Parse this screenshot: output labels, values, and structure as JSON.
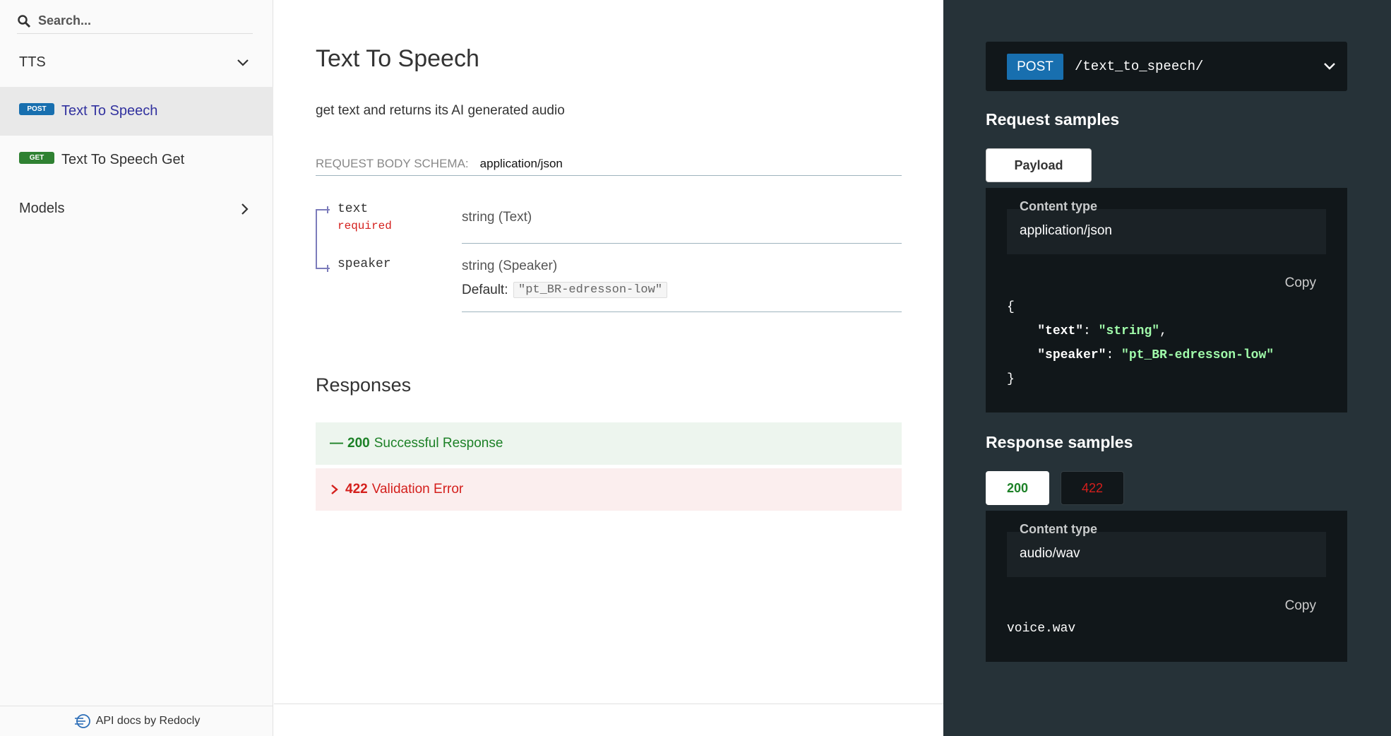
{
  "sidebar": {
    "search_placeholder": "Search...",
    "groups": [
      {
        "label": "TTS",
        "icon": "chevron-down-icon"
      },
      {
        "label": "Models",
        "icon": "chevron-right-icon"
      }
    ],
    "items": [
      {
        "method": "POST",
        "label": "Text To Speech",
        "active": true
      },
      {
        "method": "GET",
        "label": "Text To Speech Get",
        "active": false
      }
    ],
    "footer": "API docs by Redocly"
  },
  "main": {
    "title": "Text To Speech",
    "description": "get text and returns its AI generated audio",
    "schema_label": "REQUEST BODY SCHEMA:",
    "schema_type": "application/json",
    "fields": [
      {
        "name": "text",
        "required": "required",
        "type": "string (Text)"
      },
      {
        "name": "speaker",
        "type": "string (Speaker)",
        "default_label": "Default:",
        "default_value": "\"pt_BR-edresson-low\""
      }
    ],
    "responses_title": "Responses",
    "responses": [
      {
        "prefix": "—",
        "code": "200",
        "label": "Successful Response",
        "color": "#1d8127"
      },
      {
        "prefix": ">",
        "code": "422",
        "label": "Validation Error",
        "color": "#d41f1c"
      }
    ]
  },
  "panel": {
    "method": "POST",
    "path": "/text_to_speech/",
    "request_title": "Request samples",
    "request_tab": "Payload",
    "request_content_type_label": "Content type",
    "request_content_type": "application/json",
    "copy_label": "Copy",
    "payload": {
      "open": "{",
      "key1": "\"text\"",
      "val1": "\"string\"",
      "key2": "\"speaker\"",
      "val2": "\"pt_BR-edresson-low\"",
      "close": "}"
    },
    "response_title": "Response samples",
    "response_tabs": [
      "200",
      "422"
    ],
    "response_content_type_label": "Content type",
    "response_content_type": "audio/wav",
    "response_body": "voice.wav"
  },
  "colors": {
    "post": "#186faf",
    "get": "#2f8132",
    "success": "#1d8127",
    "error": "#d41f1c",
    "panel_bg": "#263238"
  }
}
